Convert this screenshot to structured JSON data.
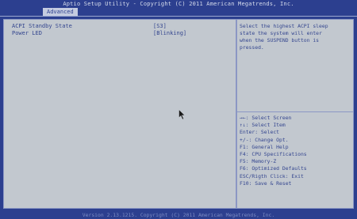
{
  "header": {
    "title": "Aptio Setup Utility - Copyright (C) 2011 American Megatrends, Inc."
  },
  "tabs": [
    {
      "label": "Advanced",
      "active": true
    }
  ],
  "settings": [
    {
      "label": "ACPI Standby State",
      "value": "[S3]"
    },
    {
      "label": "Power LED",
      "value": "[Blinking]"
    }
  ],
  "help": {
    "description": [
      "Select the highest ACPI sleep",
      "state the system will enter",
      "when the SUSPEND button is",
      "pressed."
    ],
    "keys": [
      "→←: Select Screen",
      "↑↓: Select Item",
      "Enter: Select",
      "+/-: Change Opt.",
      "F1: General Help",
      "F4: CPU Specifications",
      "F5: Memory-Z",
      "F6: Optimized Defaults",
      "ESC/Rigth Click: Exit",
      "F10: Save & Reset"
    ]
  },
  "footer": {
    "text": "Version 2.13.1215. Copyright (C) 2011 American Megatrends, Inc."
  },
  "colors": {
    "background": "#2c3f8f",
    "panel": "#c2c8cf",
    "text": "#34468f",
    "tab_active_bg": "#c4cbe0"
  },
  "icons": {
    "mouse_cursor": "arrow-pointer-icon"
  }
}
